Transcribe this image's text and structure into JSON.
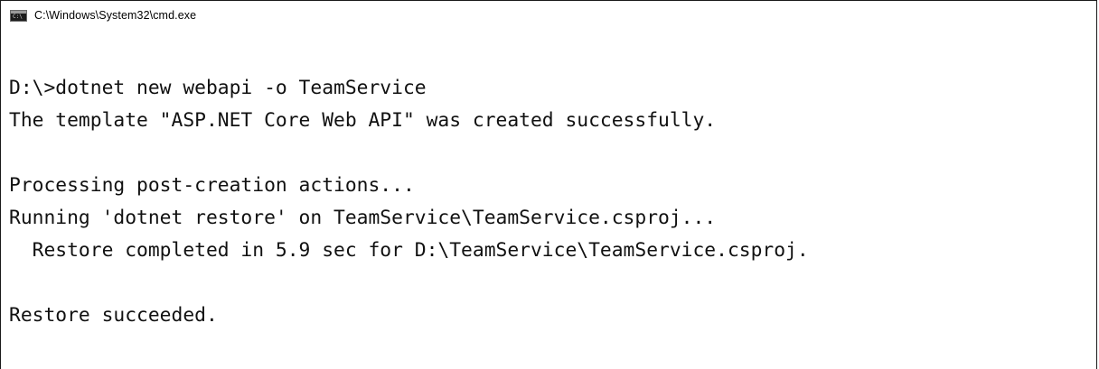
{
  "window": {
    "title": "C:\\Windows\\System32\\cmd.exe",
    "icon": "cmd-console-icon",
    "icon_text": "C:\\"
  },
  "console": {
    "lines": [
      "D:\\>dotnet new webapi -o TeamService",
      "The template \"ASP.NET Core Web API\" was created successfully.",
      "",
      "Processing post-creation actions...",
      "Running 'dotnet restore' on TeamService\\TeamService.csproj...",
      "  Restore completed in 5.9 sec for D:\\TeamService\\TeamService.csproj.",
      "",
      "Restore succeeded."
    ]
  }
}
